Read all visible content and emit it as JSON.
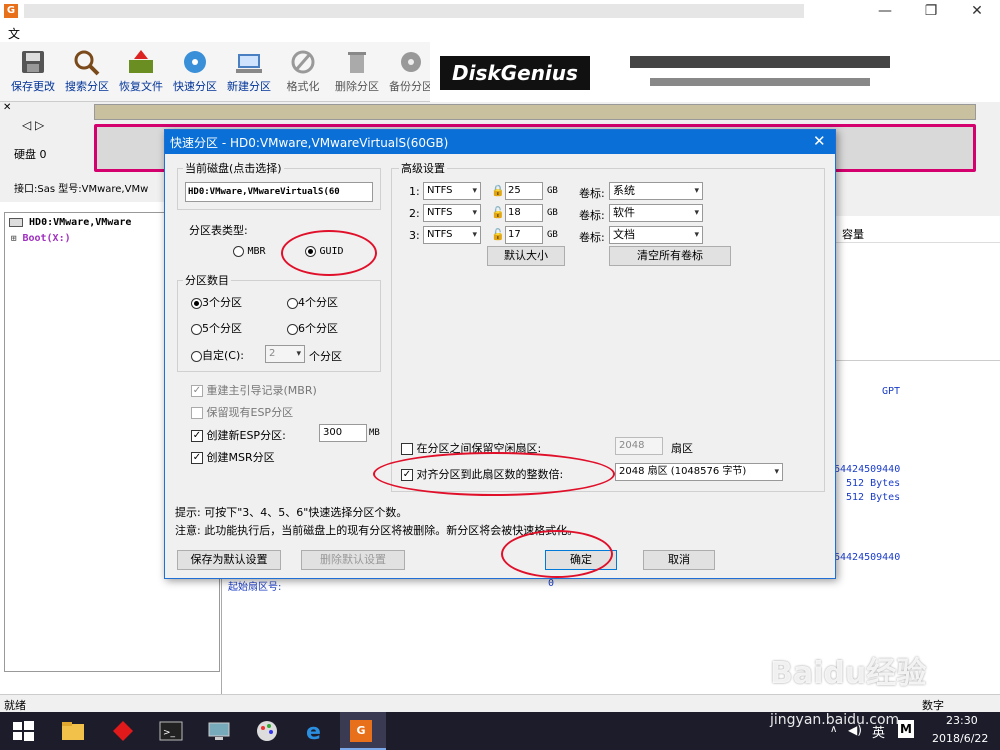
{
  "menu": {
    "file": "文"
  },
  "toolbar": [
    {
      "label": "保存更改",
      "icon": "save-icon"
    },
    {
      "label": "搜索分区",
      "icon": "search-icon"
    },
    {
      "label": "恢复文件",
      "icon": "recover-icon"
    },
    {
      "label": "快速分区",
      "icon": "quick-partition-icon"
    },
    {
      "label": "新建分区",
      "icon": "new-partition-icon"
    },
    {
      "label": "格式化",
      "icon": "format-icon"
    },
    {
      "label": "删除分区",
      "icon": "delete-icon"
    },
    {
      "label": "备份分区",
      "icon": "backup-icon"
    }
  ],
  "banner": {
    "logo": "DiskGenius"
  },
  "disk_info": {
    "disk": "硬盘 0",
    "iface": "接口:Sas  型号:VMware,VMw"
  },
  "tree": {
    "disk": "HD0:VMware,VMware",
    "boot": "Boot(X:)"
  },
  "right": {
    "col_capacity": "容量",
    "gpt": "GPT",
    "val1": "64424509440",
    "val2": "512 Bytes",
    "val3": "512 Bytes",
    "val4": "64424509440",
    "start_label": "起始扇区号:",
    "start_val": "0"
  },
  "status": {
    "left": "就绪",
    "right": "数字"
  },
  "taskbar": {
    "ime": "英",
    "time": "23:30",
    "date": "2018/6/22"
  },
  "watermark": {
    "brand": "Baidu经验",
    "url": "jingyan.baidu.com"
  },
  "dialog": {
    "title": "快速分区 - HD0:VMware,VMwareVirtualS(60GB)",
    "current_disk_label": "当前磁盘(点击选择)",
    "current_disk_value": "HD0:VMware,VMwareVirtualS(60",
    "ptype_label": "分区表类型:",
    "mbr": "MBR",
    "guid": "GUID",
    "count_label": "分区数目",
    "opt3": "3个分区",
    "opt4": "4个分区",
    "opt5": "5个分区",
    "opt6": "6个分区",
    "custom": "自定(C):",
    "custom_val": "2",
    "custom_unit": "个分区",
    "rebuild_mbr": "重建主引导记录(MBR)",
    "keep_esp": "保留现有ESP分区",
    "create_esp": "创建新ESP分区:",
    "esp_size": "300",
    "esp_unit": "MB",
    "create_msr": "创建MSR分区",
    "adv_label": "高级设置",
    "rows": [
      {
        "idx": "1:",
        "fs": "NTFS",
        "size": "25",
        "unit": "GB",
        "vol_label": "卷标:",
        "vol": "系统"
      },
      {
        "idx": "2:",
        "fs": "NTFS",
        "size": "18",
        "unit": "GB",
        "vol_label": "卷标:",
        "vol": "软件"
      },
      {
        "idx": "3:",
        "fs": "NTFS",
        "size": "17",
        "unit": "GB",
        "vol_label": "卷标:",
        "vol": "文档"
      }
    ],
    "default_size": "默认大小",
    "clear_labels": "清空所有卷标",
    "keep_free": "在分区之间保留空闲扇区:",
    "keep_free_val": "2048",
    "keep_free_unit": "扇区",
    "align": "对齐分区到此扇区数的整数倍:",
    "align_val": "2048 扇区 (1048576 字节)",
    "tip": "提示: 可按下\"3、4、5、6\"快速选择分区个数。",
    "note": "注意: 此功能执行后，当前磁盘上的现有分区将被删除。新分区将会被快速格式化。",
    "save_default": "保存为默认设置",
    "delete_default": "删除默认设置",
    "ok": "确定",
    "cancel": "取消"
  }
}
